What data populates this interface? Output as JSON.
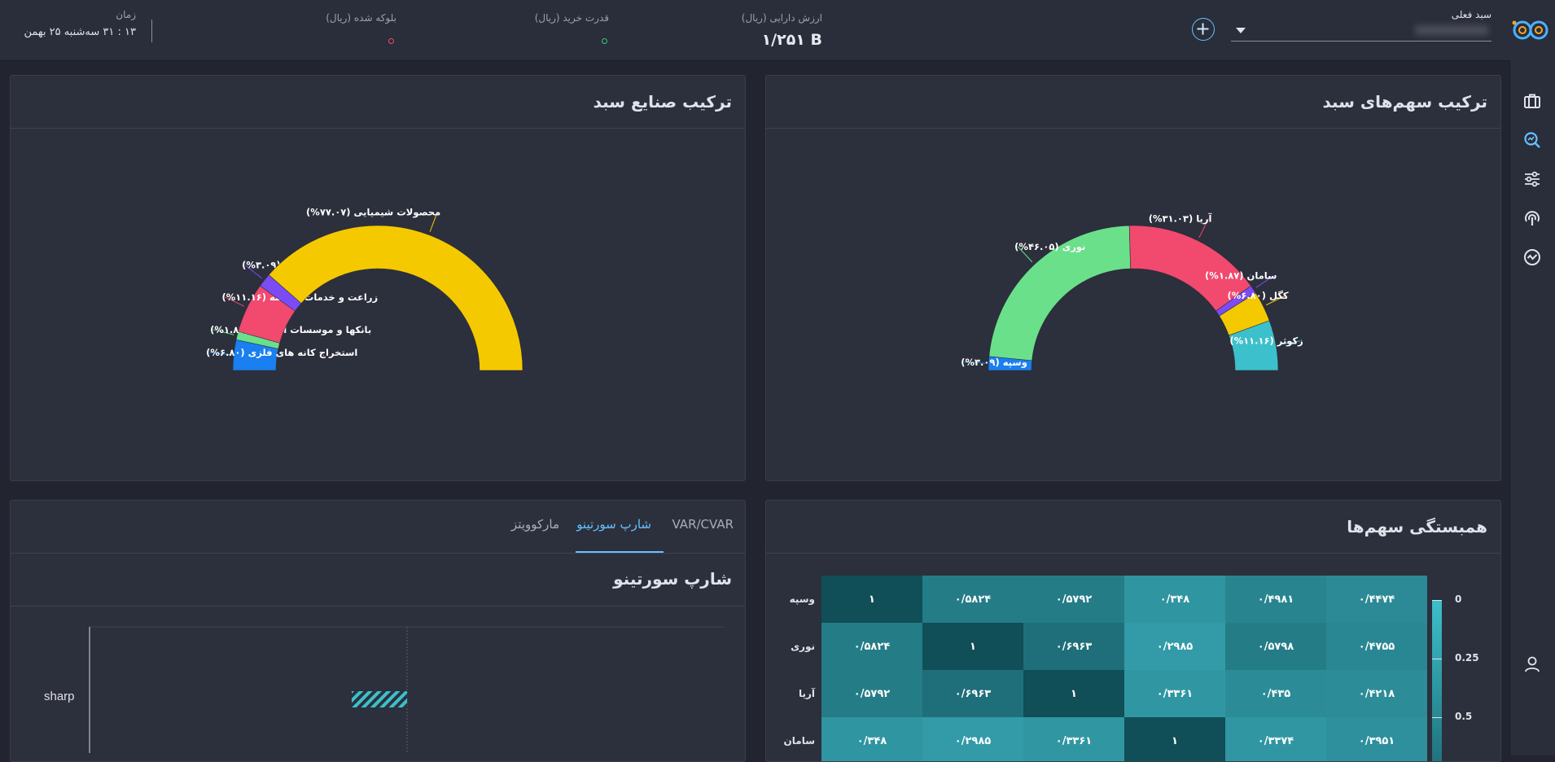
{
  "topbar": {
    "current_basket_label": "سبد فعلی",
    "asset_value_label": "ارزش دارایی (ریال)",
    "asset_value": "۱/۲۵۱ B",
    "buying_power_label": "قدرت خرید (ریال)",
    "blocked_label": "بلوکه شده (ریال)",
    "time_label": "زمان",
    "time_value": "۱۳ : ۳۱ سه‌شنبه ۲۵ بهمن"
  },
  "sidebar": {
    "icons": [
      "briefcase-icon",
      "search-chart-icon",
      "sliders-icon",
      "broadcast-icon",
      "analytics-icon",
      "user-icon"
    ]
  },
  "panels": {
    "stocks": {
      "title": "ترکیب سهم‌های سبد"
    },
    "industries": {
      "title": "ترکیب صنایع سبد"
    },
    "correlation": {
      "title": "همبستگی سهم‌ها"
    },
    "risk": {
      "tabs": [
        "VAR/CVAR",
        "شارپ سورتینو",
        "مارکوویتز"
      ],
      "active_tab": "شارپ سورتینو",
      "section_title": "شارپ سورتینو",
      "row_label": "sharp"
    }
  },
  "colors": {
    "blue": "#1a7ff0",
    "green": "#6ae08a",
    "pink": "#f2496f",
    "purple": "#7b4cf5",
    "yellow": "#f5c900",
    "teal": "#3cc0cb",
    "accent": "#64c2ff"
  },
  "chart_data": [
    {
      "type": "pie",
      "variant": "semi-donut",
      "title": "ترکیب سهم‌های سبد",
      "slices": [
        {
          "label": "وسپه (۳.۰۹%)",
          "value": 3.09,
          "color": "#1a7ff0"
        },
        {
          "label": "نوری (۴۶.۰۵%)",
          "value": 46.05,
          "color": "#6ae08a"
        },
        {
          "label": "آریا (۳۱.۰۳%)",
          "value": 31.03,
          "color": "#f2496f"
        },
        {
          "label": "سامان (۱.۸۷%)",
          "value": 1.87,
          "color": "#7b4cf5"
        },
        {
          "label": "کگل (۶.۸۰%)",
          "value": 6.8,
          "color": "#f5c900"
        },
        {
          "label": "زکوثر (۱۱.۱۶%)",
          "value": 11.16,
          "color": "#3cc0cb"
        }
      ]
    },
    {
      "type": "pie",
      "variant": "semi-donut",
      "title": "ترکیب صنایع سبد",
      "slices": [
        {
          "label": "استخراج کانه های فلزی (۶.۸۰%)",
          "value": 6.8,
          "color": "#1a7ff0"
        },
        {
          "label": "بانکها و موسسات اعتباری (۱.۸۷%)",
          "value": 1.87,
          "color": "#6ae08a"
        },
        {
          "label": "زراعت و خدمات وابسته (۱۱.۱۶%)",
          "value": 11.16,
          "color": "#f2496f"
        },
        {
          "label": "سرمایه گذاریها (۳.۰۹%)",
          "value": 3.09,
          "color": "#7b4cf5"
        },
        {
          "label": "محصولات شیمیایی (۷۷.۰۷%)",
          "value": 77.07,
          "color": "#f5c900"
        }
      ]
    },
    {
      "type": "heatmap",
      "title": "همبستگی سهم‌ها",
      "rows": [
        "وسپه",
        "نوری",
        "آریا",
        "سامان"
      ],
      "values": [
        [
          1,
          0.5824,
          0.5792,
          0.348,
          0.4981,
          0.4474
        ],
        [
          0.5824,
          1,
          0.6963,
          0.2985,
          0.5798,
          0.4755
        ],
        [
          0.5792,
          0.6963,
          1,
          0.3361,
          0.435,
          0.4218
        ],
        [
          0.348,
          0.2985,
          0.3361,
          1,
          0.3374,
          0.3951
        ]
      ],
      "display": [
        [
          "۱",
          "۰/۵۸۲۴",
          "۰/۵۷۹۲",
          "۰/۳۴۸",
          "۰/۴۹۸۱",
          "۰/۴۴۷۴"
        ],
        [
          "۰/۵۸۲۴",
          "۱",
          "۰/۶۹۶۳",
          "۰/۲۹۸۵",
          "۰/۵۷۹۸",
          "۰/۴۷۵۵"
        ],
        [
          "۰/۵۷۹۲",
          "۰/۶۹۶۳",
          "۱",
          "۰/۳۳۶۱",
          "۰/۴۳۵",
          "۰/۴۲۱۸"
        ],
        [
          "۰/۳۴۸",
          "۰/۲۹۸۵",
          "۰/۳۳۶۱",
          "۱",
          "۰/۳۳۷۴",
          "۰/۳۹۵۱"
        ]
      ],
      "scale_ticks": [
        "0",
        "0.25",
        "0.5"
      ]
    }
  ]
}
